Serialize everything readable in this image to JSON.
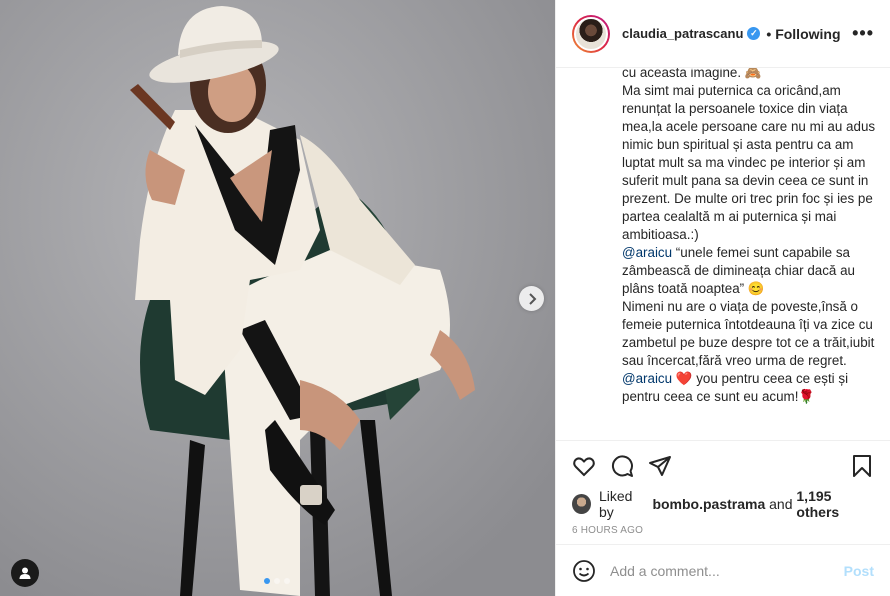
{
  "header": {
    "username": "claudia_patrascanu",
    "separator": "•",
    "follow_status": "Following"
  },
  "caption": {
    "lines": [
      "cu aceasta imagine. 🙈",
      "Ma simt mai puternica ca oricând,am renunțat la persoanele toxice din viața mea,la acele persoane care nu mi au adus nimic bun spiritual și asta pentru ca am luptat mult sa ma vindec pe interior și am suferit mult pana sa devin ceea ce sunt in prezent. De multe ori trec prin foc și ies pe partea cealaltă m ai puternica și mai ambitioasa.:)"
    ],
    "quote_mention": "@araicu",
    "quote_text": " “unele femei sunt capabile sa zâmbească de dimineața chiar dacă au plâns toată noaptea” 😊",
    "paragraph2": "Nimeni nu are o viața de poveste,însă o femeie puternica întotdeauna îți va zice cu zambetul pe buze despre tot ce a trăit,iubit sau încercat,fără vreo urma de regret.",
    "closing_mention": "@araicu",
    "closing_text": " ❤️ you pentru ceea ce ești și pentru ceea ce sunt eu acum!🌹"
  },
  "likes": {
    "prefix": "Liked by ",
    "user": "bombo.pastrama",
    "middle": " and ",
    "count": "1,195 others"
  },
  "timestamp": "6 HOURS AGO",
  "comment_box": {
    "placeholder": "Add a comment...",
    "post_label": "Post"
  },
  "icons": [
    "verified-badge-icon",
    "more-options-icon",
    "heart-icon",
    "comment-icon",
    "share-icon",
    "bookmark-icon",
    "emoji-icon",
    "chevron-right-icon",
    "user-tag-icon"
  ],
  "colors": {
    "accent": "#3897f0",
    "post_disabled": "#b2dffc",
    "mention": "#00376b"
  }
}
